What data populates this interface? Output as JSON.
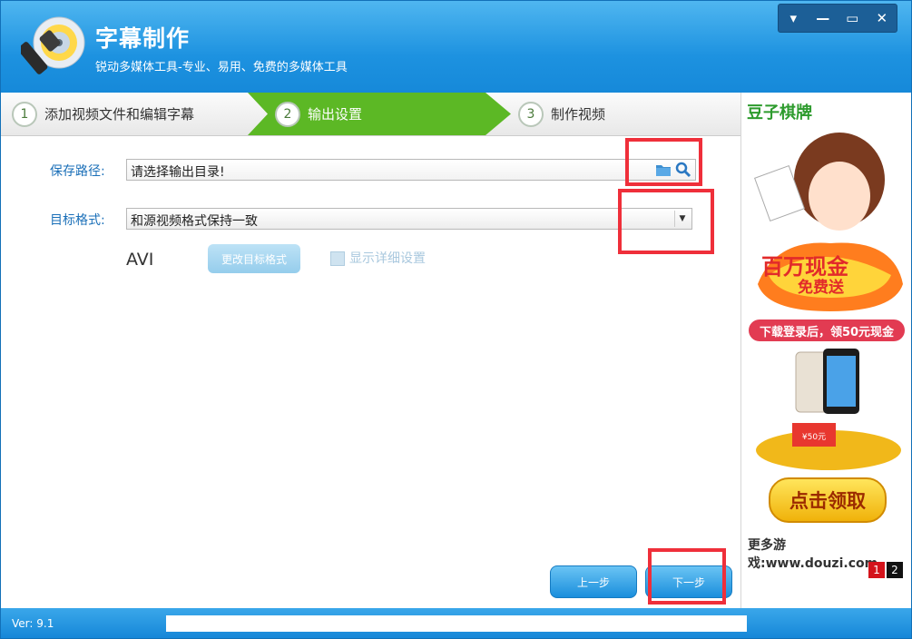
{
  "app": {
    "title": "字幕制作",
    "subtitle": "锐动多媒体工具-专业、易用、免费的多媒体工具"
  },
  "window_controls": {
    "menu": "▾",
    "minimize": "—",
    "maximize": "▭",
    "close": "✕"
  },
  "steps": [
    {
      "num": "1",
      "label": "添加视频文件和编辑字幕"
    },
    {
      "num": "2",
      "label": "输出设置"
    },
    {
      "num": "3",
      "label": "制作视频"
    }
  ],
  "form": {
    "save_path_label": "保存路径:",
    "save_path_value": "请选择输出目录!",
    "target_format_label": "目标格式:",
    "target_format_value": "和源视频格式保持一致",
    "format_name": "AVI",
    "change_format_button": "更改目标格式",
    "show_details_label": "显示详细设置"
  },
  "navigation": {
    "prev": "上一步",
    "next": "下一步"
  },
  "ad": {
    "brand": "豆子棋牌",
    "banner_text": "下载登录后，领50元现金",
    "cta": "点击领取",
    "url": "更多游戏:www.douzi.com",
    "pages": [
      "1",
      "2"
    ]
  },
  "status": {
    "version": "Ver: 9.1",
    "progress": 0
  },
  "colors": {
    "accent": "#1a8ad8",
    "step_active": "#5cb825",
    "highlight": "#ef2f3a"
  }
}
